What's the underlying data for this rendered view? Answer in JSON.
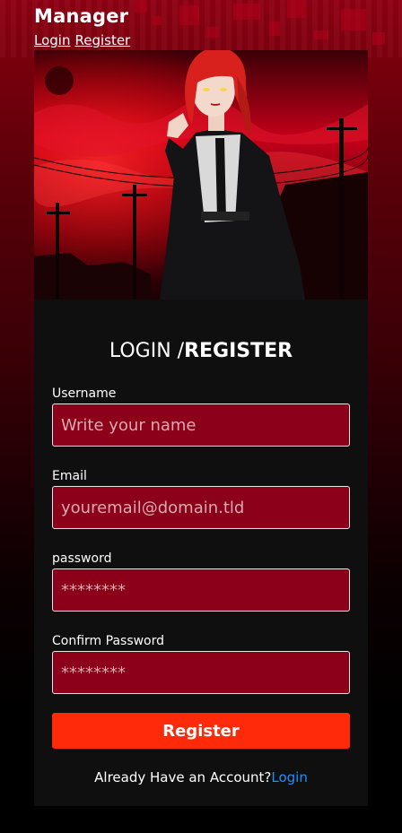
{
  "header": {
    "brand": "Manager",
    "nav": [
      {
        "label": "Login"
      },
      {
        "label": "Register"
      }
    ]
  },
  "form": {
    "title_light": "LOGIN /",
    "title_bold": "REGISTER",
    "fields": [
      {
        "label": "Username",
        "placeholder": "Write your name",
        "value": ""
      },
      {
        "label": "Email",
        "placeholder": "youremail@domain.tld",
        "value": ""
      },
      {
        "label": "password",
        "placeholder": "********",
        "value": ""
      },
      {
        "label": "Confirm Password",
        "placeholder": "********",
        "value": ""
      }
    ],
    "submit_label": "Register",
    "footer_text": "Already Have an Account?",
    "footer_link": "Login"
  },
  "colors": {
    "accent": "#ff2a0a",
    "input_bg": "#8c0019",
    "link": "#1e90ff",
    "card_bg": "#0f0f10"
  }
}
